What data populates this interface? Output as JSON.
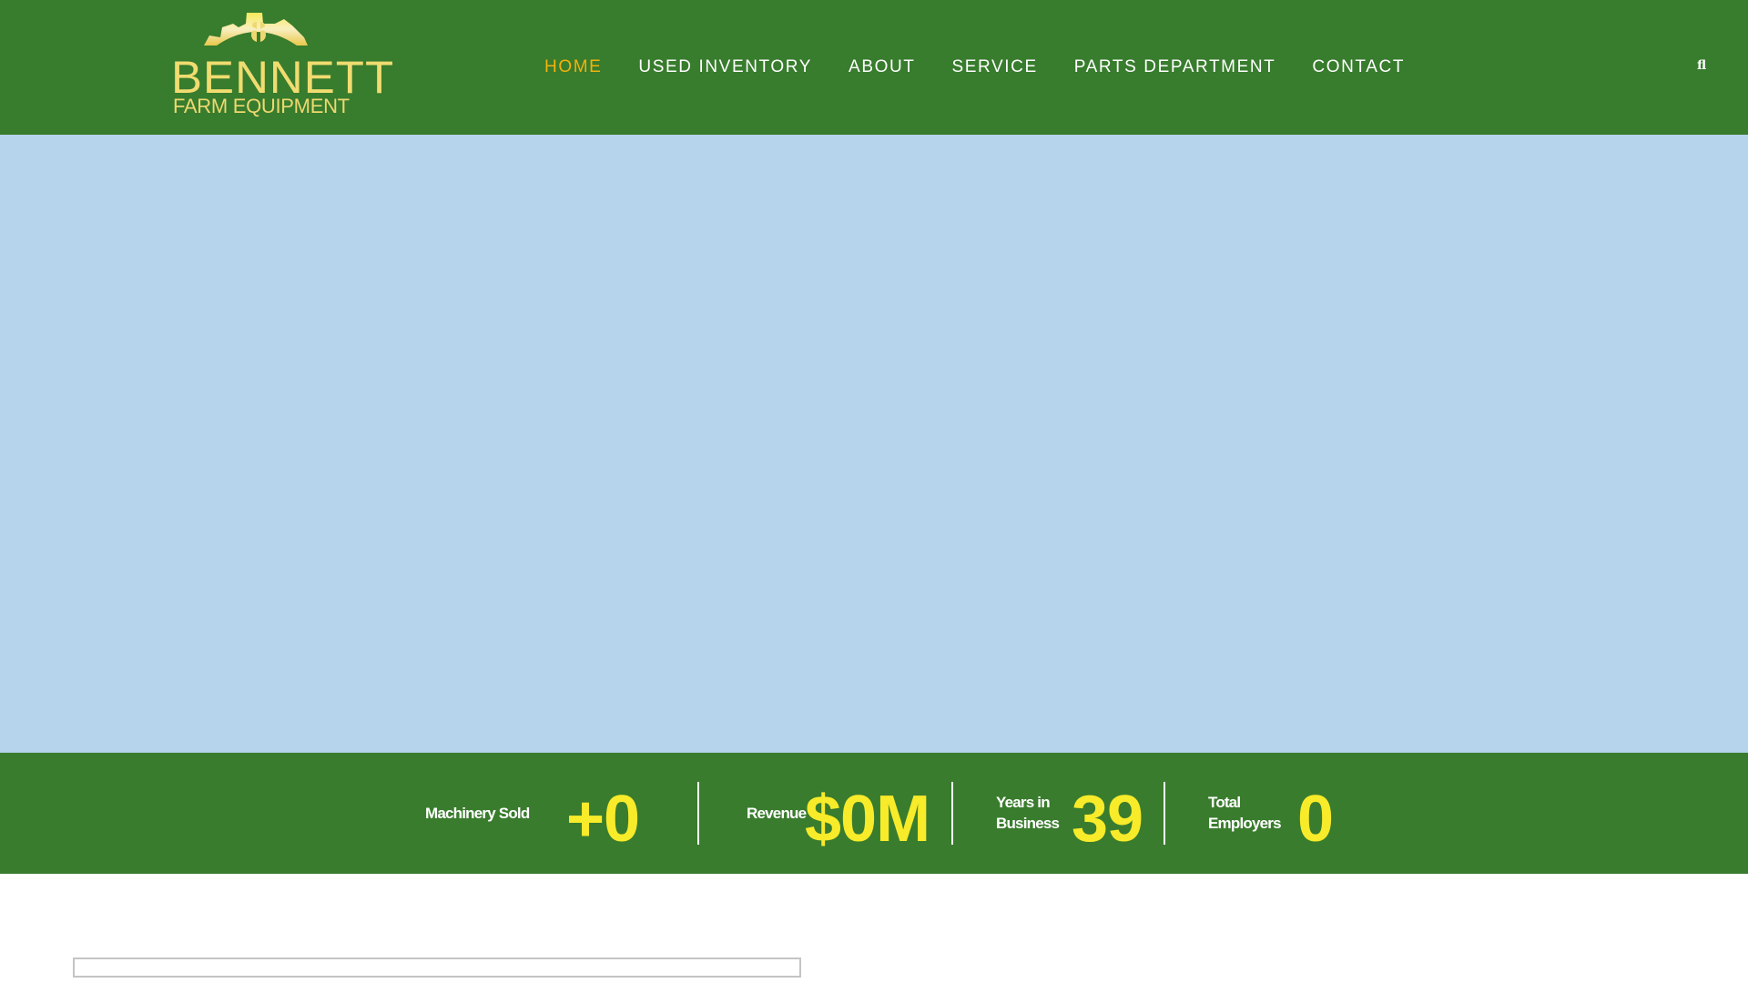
{
  "logo": {
    "line1": "BENNETT",
    "line2": "FARM EQUIPMENT",
    "colors": {
      "gold": "#f0dc70"
    }
  },
  "nav": {
    "items": [
      {
        "label": "HOME",
        "active": true
      },
      {
        "label": "USED INVENTORY"
      },
      {
        "label": "ABOUT"
      },
      {
        "label": "SERVICE"
      },
      {
        "label": "PARTS DEPARTMENT"
      },
      {
        "label": "CONTACT"
      }
    ],
    "search_icon_glyph": "fl"
  },
  "stats": [
    {
      "label": "Machinery Sold",
      "value": "+0"
    },
    {
      "label": "Revenue",
      "value": "$0M"
    },
    {
      "label_line1": "Years in",
      "label_line2": "Business",
      "value": "39"
    },
    {
      "label_line1": "Total",
      "label_line2": "Employers",
      "value": "0"
    }
  ],
  "colors": {
    "header": "#387c2d",
    "hero": "#b6d4ec",
    "accent": "#f4b10b",
    "stat_number": "#f8eb2a"
  }
}
